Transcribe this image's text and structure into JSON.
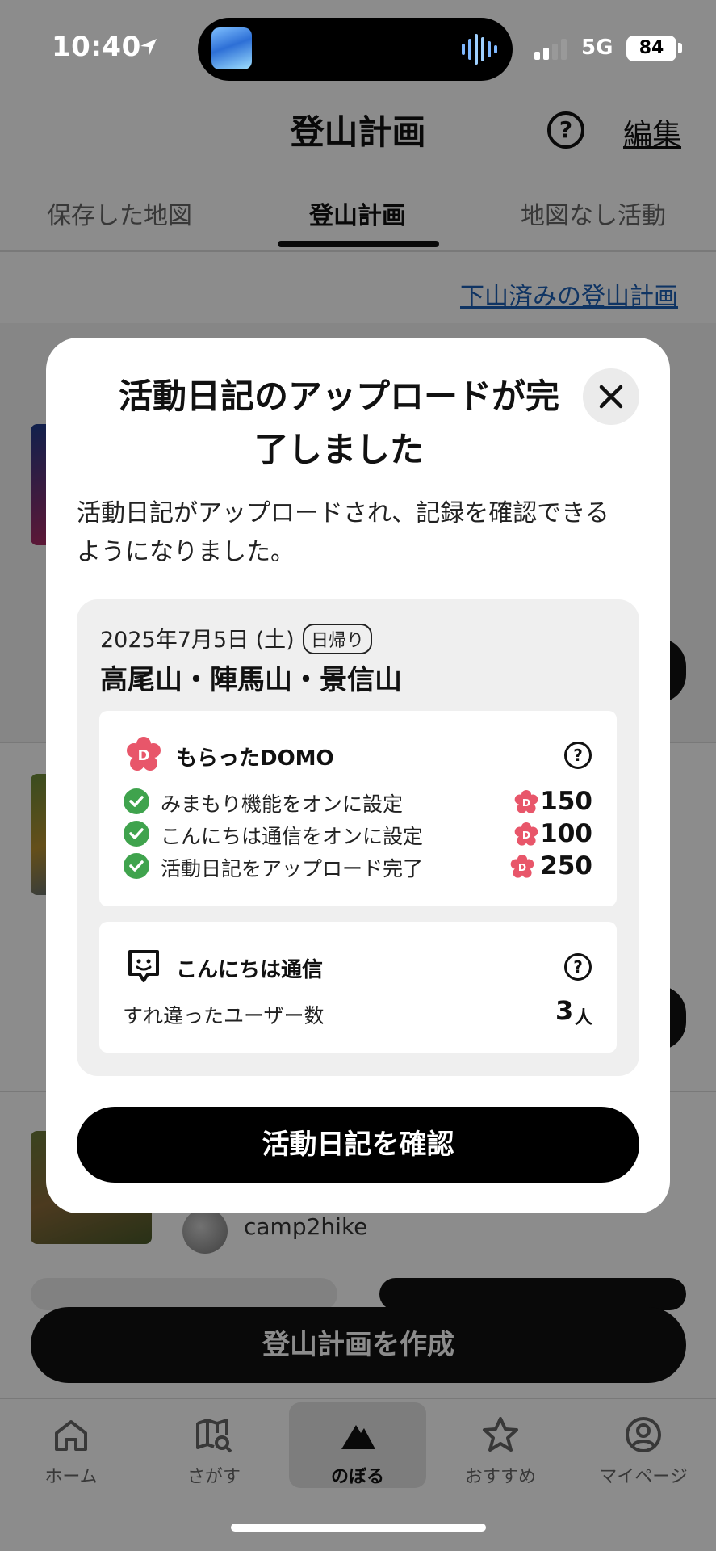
{
  "status_bar": {
    "time": "10:40",
    "network": "5G",
    "battery": "84"
  },
  "header": {
    "title": "登山計画",
    "help_icon": "?",
    "edit_label": "編集"
  },
  "tabs": [
    {
      "label": "保存した地図",
      "active": false
    },
    {
      "label": "登山計画",
      "active": true
    },
    {
      "label": "地図なし活動",
      "active": false
    }
  ],
  "done_plans_link": "下山済みの登山計画",
  "background_list": {
    "username": "camp2hike"
  },
  "create_plan_button": "登山計画を作成",
  "bottom_nav": [
    {
      "label": "ホーム",
      "icon": "home-icon"
    },
    {
      "label": "さがす",
      "icon": "map-search-icon"
    },
    {
      "label": "のぼる",
      "icon": "mountain-icon",
      "active": true
    },
    {
      "label": "おすすめ",
      "icon": "star-icon"
    },
    {
      "label": "マイページ",
      "icon": "person-icon"
    }
  ],
  "modal": {
    "title_line1": "活動日記のアップロードが完",
    "title_line2": "了しました",
    "description_line1": "活動日記がアップロードされ、記録を確認できる",
    "description_line2": "ようになりました。",
    "summary": {
      "date": "2025年7月5日 (土)",
      "badge": "日帰り",
      "peaks": "高尾山・陣馬山・景信山"
    },
    "domo": {
      "heading": "もらったDOMO",
      "rewards": [
        {
          "label": "みまもり機能をオンに設定",
          "points": "150"
        },
        {
          "label": "こんにちは通信をオンに設定",
          "points": "100"
        },
        {
          "label": "活動日記をアップロード完了",
          "points": "250"
        }
      ]
    },
    "konnichiwa": {
      "heading": "こんにちは通信",
      "users_label": "すれ違ったユーザー数",
      "users_count": "3",
      "users_unit": "人"
    },
    "confirm_button": "活動日記を確認"
  },
  "colors": {
    "check_green": "#3fa34d",
    "domo_pink": "#e8566a",
    "link_blue": "#1d5fb5"
  }
}
